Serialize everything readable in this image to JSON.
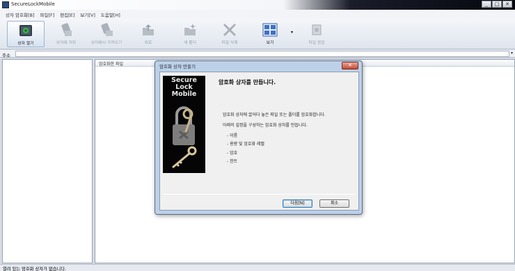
{
  "window": {
    "title": "SecureLockMobile",
    "controls": [
      "_",
      "□",
      "✕"
    ]
  },
  "menu": [
    {
      "id": "container",
      "label": "상자 암호화[B]"
    },
    {
      "id": "file",
      "label": "파일[F]"
    },
    {
      "id": "edit",
      "label": "편집[E]"
    },
    {
      "id": "view",
      "label": "보기[V]"
    },
    {
      "id": "help",
      "label": "도움말[H]"
    }
  ],
  "toolbar": {
    "open_container": "상자 열기",
    "save_to_container": "상자에 저장",
    "get_from_container": "상자에서 가져오기",
    "up": "위로",
    "new_folder": "새 폴더",
    "delete_file": "파일 삭제",
    "view": "보기",
    "edit_file": "파일 편집"
  },
  "address": {
    "label": "주소",
    "value": ""
  },
  "panes": {
    "right_header": "암호화한 파일"
  },
  "status": {
    "text": "열려 있는 암호화 상자가 없습니다."
  },
  "dialog": {
    "title": "암호화 상자 만들기",
    "close": "✕",
    "brand_line1": "Secure",
    "brand_line2": "Lock",
    "brand_line3": "Mobile",
    "heading": "암호화 상자를 만듭니다.",
    "intro": "암호화 상자에 끌어다 놓은 파일 또는 폴더를 암호화합니다.",
    "sub": "아래의 설정을 구성하는 암호화 상자를 만듭니다.",
    "items": [
      "- 이름",
      "- 용량 및 암호화 레벨",
      "- 암호",
      "- 힌트"
    ],
    "next": "다음[N]",
    "cancel": "취소"
  }
}
